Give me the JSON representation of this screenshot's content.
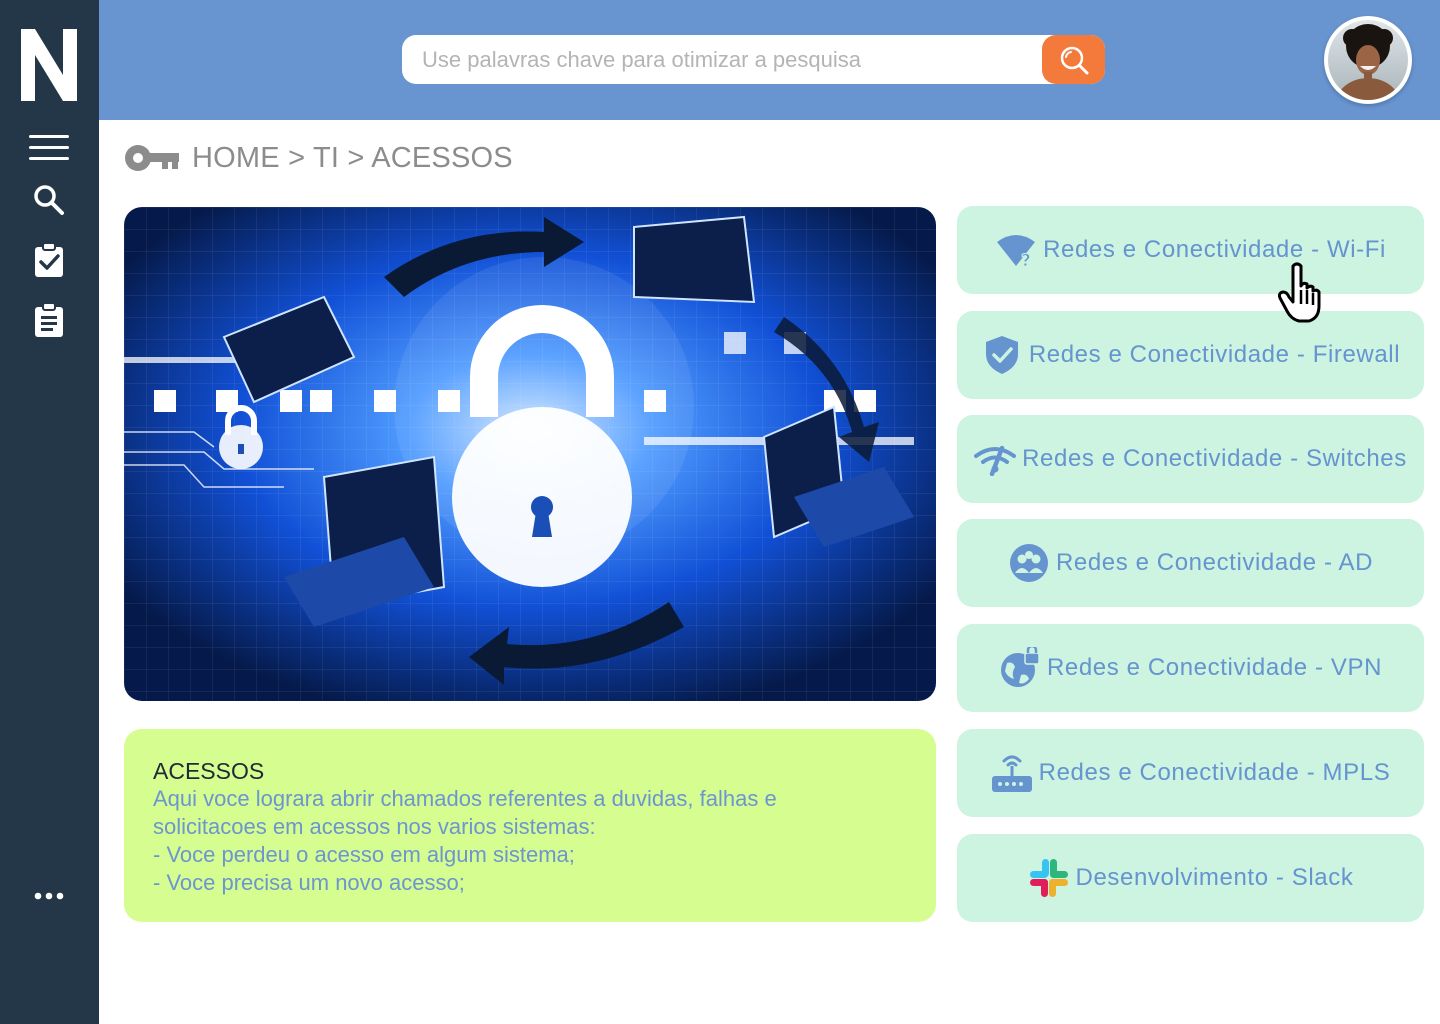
{
  "app": {
    "logo_letter": "N"
  },
  "sidebar": {
    "items": [
      {
        "name": "menu-icon"
      },
      {
        "name": "search-icon"
      },
      {
        "name": "tasks-checked-icon"
      },
      {
        "name": "clipboard-icon"
      },
      {
        "name": "more-icon"
      }
    ]
  },
  "header": {
    "search": {
      "placeholder": "Use palavras chave para otimizar a pesquisa",
      "value": ""
    }
  },
  "breadcrumb": {
    "items": [
      "HOME",
      "TI",
      "ACESSOS"
    ],
    "separator": ">"
  },
  "info": {
    "title": "ACESSOS",
    "lines": [
      "Aqui voce lograra abrir chamados referentes a duvidas, falhas e",
      "solicitacoes em acessos nos varios sistemas:",
      "- Voce perdeu o acesso em algum sistema;",
      "- Voce precisa um novo acesso;"
    ]
  },
  "categories": [
    {
      "label": "Redes e Conectividade - Wi-Fi",
      "icon": "wifi-question-icon"
    },
    {
      "label": "Redes e Conectividade - Firewall",
      "icon": "shield-check-icon"
    },
    {
      "label": "Redes e Conectividade - Switches",
      "icon": "network-signal-icon"
    },
    {
      "label": "Redes e Conectividade - AD",
      "icon": "users-group-icon"
    },
    {
      "label": "Redes e Conectividade - VPN",
      "icon": "globe-lock-icon"
    },
    {
      "label": "Redes e Conectividade - MPLS",
      "icon": "router-icon"
    },
    {
      "label": "Desenvolvimento - Slack",
      "icon": "slack-icon"
    }
  ],
  "colors": {
    "sidebar": "#243749",
    "header": "#6894d0",
    "search_button": "#f47a3b",
    "card_bg": "#cdf3e1",
    "card_text": "#6594cf",
    "info_bg": "#d5fd90",
    "breadcrumb_text": "#8c8c8c"
  }
}
